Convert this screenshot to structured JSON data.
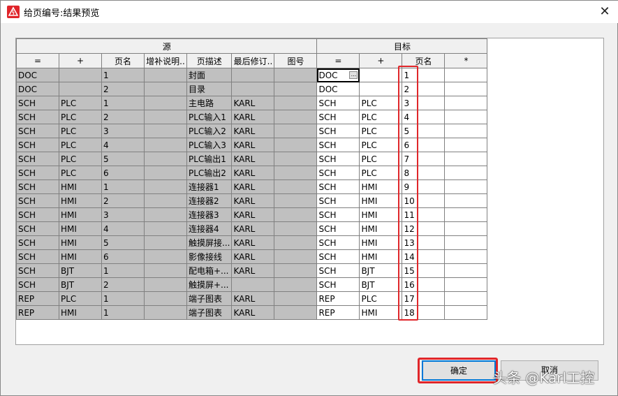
{
  "window": {
    "title": "给页编号:结果预览",
    "close": "✕"
  },
  "headers": {
    "source_group": "源",
    "target_group": "目标",
    "source_cols": [
      "=",
      "+",
      "页名",
      "增补说明..",
      "页描述",
      "最后修订..",
      "图号"
    ],
    "target_cols": [
      "=",
      "+",
      "页名",
      "*"
    ]
  },
  "rows": [
    {
      "s": [
        "DOC",
        "",
        "1",
        "",
        "封面",
        "",
        ""
      ],
      "t": [
        "DOC",
        "",
        "1",
        ""
      ]
    },
    {
      "s": [
        "DOC",
        "",
        "2",
        "",
        "目录",
        "",
        ""
      ],
      "t": [
        "DOC",
        "",
        "2",
        ""
      ]
    },
    {
      "s": [
        "SCH",
        "PLC",
        "1",
        "",
        "主电路",
        "KARL",
        ""
      ],
      "t": [
        "SCH",
        "PLC",
        "3",
        ""
      ]
    },
    {
      "s": [
        "SCH",
        "PLC",
        "2",
        "",
        "PLC输入1",
        "KARL",
        ""
      ],
      "t": [
        "SCH",
        "PLC",
        "4",
        ""
      ]
    },
    {
      "s": [
        "SCH",
        "PLC",
        "3",
        "",
        "PLC输入2",
        "KARL",
        ""
      ],
      "t": [
        "SCH",
        "PLC",
        "5",
        ""
      ]
    },
    {
      "s": [
        "SCH",
        "PLC",
        "4",
        "",
        "PLC输入3",
        "KARL",
        ""
      ],
      "t": [
        "SCH",
        "PLC",
        "6",
        ""
      ]
    },
    {
      "s": [
        "SCH",
        "PLC",
        "5",
        "",
        "PLC输出1",
        "KARL",
        ""
      ],
      "t": [
        "SCH",
        "PLC",
        "7",
        ""
      ]
    },
    {
      "s": [
        "SCH",
        "PLC",
        "6",
        "",
        "PLC输出2",
        "KARL",
        ""
      ],
      "t": [
        "SCH",
        "PLC",
        "8",
        ""
      ]
    },
    {
      "s": [
        "SCH",
        "HMI",
        "1",
        "",
        "连接器1",
        "KARL",
        ""
      ],
      "t": [
        "SCH",
        "HMI",
        "9",
        ""
      ]
    },
    {
      "s": [
        "SCH",
        "HMI",
        "2",
        "",
        "连接器2",
        "KARL",
        ""
      ],
      "t": [
        "SCH",
        "HMI",
        "10",
        ""
      ]
    },
    {
      "s": [
        "SCH",
        "HMI",
        "3",
        "",
        "连接器3",
        "KARL",
        ""
      ],
      "t": [
        "SCH",
        "HMI",
        "11",
        ""
      ]
    },
    {
      "s": [
        "SCH",
        "HMI",
        "4",
        "",
        "连接器4",
        "KARL",
        ""
      ],
      "t": [
        "SCH",
        "HMI",
        "12",
        ""
      ]
    },
    {
      "s": [
        "SCH",
        "HMI",
        "5",
        "",
        "触摸屏接...",
        "KARL",
        ""
      ],
      "t": [
        "SCH",
        "HMI",
        "13",
        ""
      ]
    },
    {
      "s": [
        "SCH",
        "HMI",
        "6",
        "",
        "影像接线",
        "KARL",
        ""
      ],
      "t": [
        "SCH",
        "HMI",
        "14",
        ""
      ]
    },
    {
      "s": [
        "SCH",
        "BJT",
        "1",
        "",
        "配电箱+...",
        "KARL",
        ""
      ],
      "t": [
        "SCH",
        "BJT",
        "15",
        ""
      ]
    },
    {
      "s": [
        "SCH",
        "BJT",
        "2",
        "",
        "触摸屏+...",
        "",
        ""
      ],
      "t": [
        "SCH",
        "BJT",
        "16",
        ""
      ]
    },
    {
      "s": [
        "REP",
        "PLC",
        "1",
        "",
        "端子图表",
        "KARL",
        ""
      ],
      "t": [
        "REP",
        "PLC",
        "17",
        ""
      ]
    },
    {
      "s": [
        "REP",
        "HMI",
        "1",
        "",
        "端子图表",
        "KARL",
        ""
      ],
      "t": [
        "REP",
        "HMI",
        "18",
        ""
      ]
    }
  ],
  "buttons": {
    "ok": "确定",
    "cancel": "取消"
  },
  "watermark": "头条 @Karl工控",
  "colors": {
    "highlight": "#e0262a",
    "source_cell": "#c0c0c0",
    "focus": "#0078d7"
  }
}
